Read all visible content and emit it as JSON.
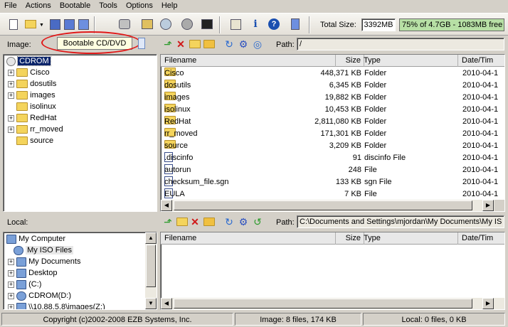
{
  "menu": [
    "File",
    "Actions",
    "Bootable",
    "Tools",
    "Options",
    "Help"
  ],
  "toolbar": {
    "total_size_label": "Total Size:",
    "total_size_value": "3392MB",
    "capacity_text": "75% of 4.7GB - 1083MB free"
  },
  "image_pane": {
    "label": "Image:",
    "type_value": "Bootable CD/DVD",
    "path_label": "Path:",
    "path_value": "/"
  },
  "image_tree": {
    "root": "CDROM",
    "children": [
      "Cisco",
      "dosutils",
      "images",
      "isolinux",
      "RedHat",
      "rr_moved",
      "source"
    ]
  },
  "file_columns": [
    "Filename",
    "Size",
    "Type",
    "Date/Tim"
  ],
  "image_files": [
    {
      "name": "Cisco",
      "size": "448,371 KB",
      "type": "Folder",
      "date": "2010-04-1",
      "kind": "folder"
    },
    {
      "name": "dosutils",
      "size": "6,345 KB",
      "type": "Folder",
      "date": "2010-04-1",
      "kind": "folder"
    },
    {
      "name": "images",
      "size": "19,882 KB",
      "type": "Folder",
      "date": "2010-04-1",
      "kind": "folder"
    },
    {
      "name": "isolinux",
      "size": "10,453 KB",
      "type": "Folder",
      "date": "2010-04-1",
      "kind": "folder"
    },
    {
      "name": "RedHat",
      "size": "2,811,080 KB",
      "type": "Folder",
      "date": "2010-04-1",
      "kind": "folder"
    },
    {
      "name": "rr_moved",
      "size": "171,301 KB",
      "type": "Folder",
      "date": "2010-04-1",
      "kind": "folder"
    },
    {
      "name": "source",
      "size": "3,209 KB",
      "type": "Folder",
      "date": "2010-04-1",
      "kind": "folder"
    },
    {
      "name": ".discinfo",
      "size": "91",
      "type": "discinfo File",
      "date": "2010-04-1",
      "kind": "file"
    },
    {
      "name": "autorun",
      "size": "248",
      "type": "File",
      "date": "2010-04-1",
      "kind": "file"
    },
    {
      "name": "checksum_file.sgn",
      "size": "133 KB",
      "type": "sgn File",
      "date": "2010-04-1",
      "kind": "file"
    },
    {
      "name": "EULA",
      "size": "7 KB",
      "type": "File",
      "date": "2010-04-1",
      "kind": "file"
    }
  ],
  "local_pane": {
    "label": "Local:",
    "path_label": "Path:",
    "path_value": "C:\\Documents and Settings\\mjordan\\My Documents\\My IS"
  },
  "local_tree": [
    "My Computer",
    "My ISO Files",
    "My Documents",
    "Desktop",
    "(C:)",
    "CDROM(D:)",
    "\\\\10.88.5.8\\images(Z:)"
  ],
  "status": {
    "copyright": "Copyright (c)2002-2008 EZB Systems, Inc.",
    "image": "Image: 8 files, 174 KB",
    "local": "Local: 0 files, 0 KB"
  }
}
